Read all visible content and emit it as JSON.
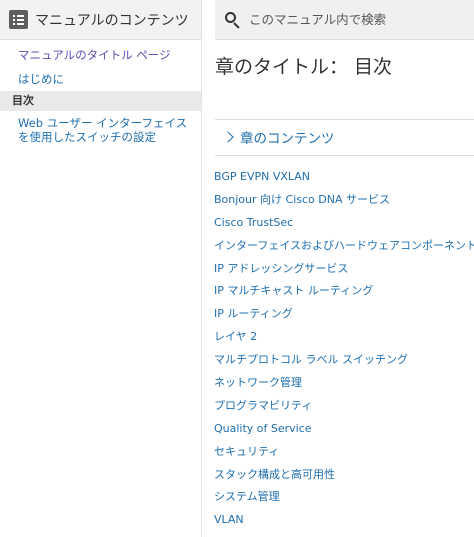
{
  "sidebar": {
    "title": "マニュアルのコンテンツ",
    "items": [
      {
        "label": "マニュアルのタイトル ページ"
      },
      {
        "label": "はじめに"
      },
      {
        "label": "目次"
      },
      {
        "label": "Web ユーザー インターフェイスを使用したスイッチの設定"
      }
    ]
  },
  "search": {
    "placeholder": "このマニュアル内で検索"
  },
  "main": {
    "page_title": "章のタイトル： 目次",
    "section_label": "章のコンテンツ",
    "chapters": [
      "BGP EVPN VXLAN",
      "Bonjour 向け Cisco DNA サービス",
      "Cisco TrustSec",
      "インターフェイスおよびハードウェアコンポーネント",
      "IP アドレッシングサービス",
      "IP マルチキャスト ルーティング",
      "IP ルーティング",
      "レイヤ 2",
      "マルチプロトコル ラベル スイッチング",
      "ネットワーク管理",
      "プログラマビリティ",
      "Quality of Service",
      "セキュリティ",
      "スタック構成と高可用性",
      "システム管理",
      "VLAN"
    ]
  },
  "colors": {
    "link": "#1f6fb0",
    "visited_link": "#5a4fb3",
    "header_bg": "#f2f2f2",
    "active_bg": "#e9e9e9"
  }
}
